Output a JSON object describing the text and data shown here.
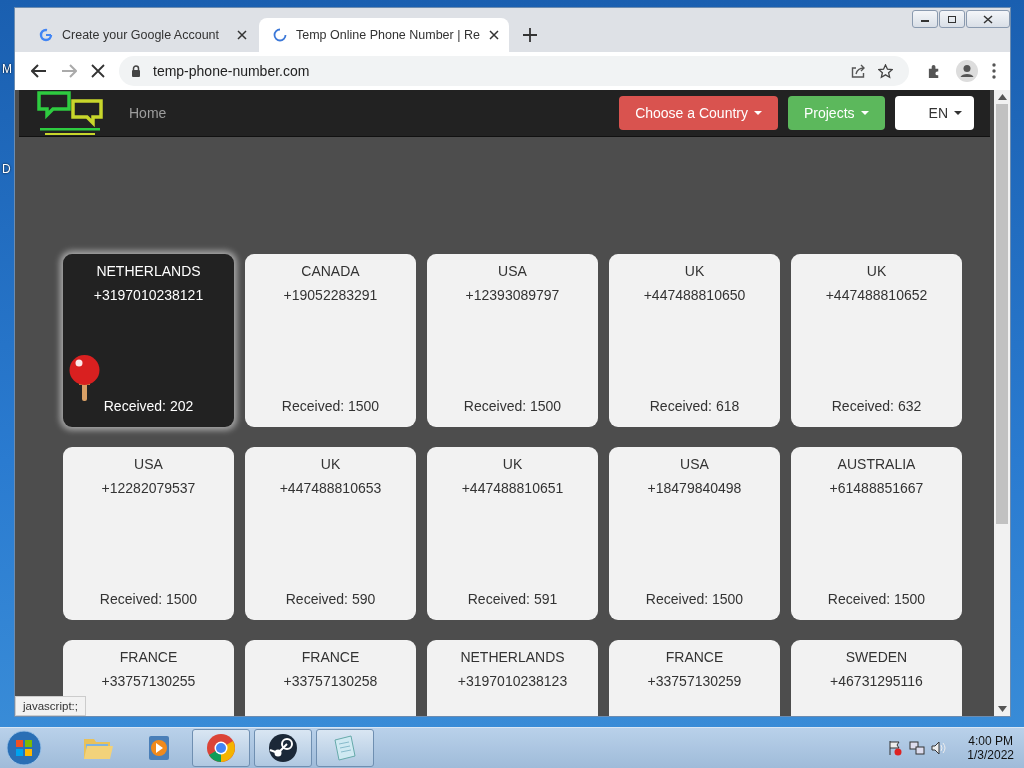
{
  "desktop_labels": [
    "M",
    "D"
  ],
  "browser": {
    "tabs": [
      {
        "title": "Create your Google Account",
        "selected": false,
        "loading": false
      },
      {
        "title": "Temp Online Phone Number | Re",
        "selected": true,
        "loading": true
      }
    ],
    "address": "temp-phone-number.com",
    "loading": true,
    "status_text": "javascript:;"
  },
  "page": {
    "nav": {
      "home": "Home",
      "buttons": [
        {
          "label": "Choose a Country",
          "color": "#d9534f"
        },
        {
          "label": "Projects",
          "color": "#5cb85c"
        },
        {
          "label": "EN",
          "color": "#ffffff"
        }
      ]
    },
    "cards": [
      {
        "country": "NETHERLANDS",
        "number": "+3197010238121",
        "received": "Received: 202",
        "highlighted": true
      },
      {
        "country": "CANADA",
        "number": "+19052283291",
        "received": "Received: 1500",
        "highlighted": false
      },
      {
        "country": "USA",
        "number": "+12393089797",
        "received": "Received: 1500",
        "highlighted": false
      },
      {
        "country": "UK",
        "number": "+447488810650",
        "received": "Received: 618",
        "highlighted": false
      },
      {
        "country": "UK",
        "number": "+447488810652",
        "received": "Received: 632",
        "highlighted": false
      },
      {
        "country": "USA",
        "number": "+12282079537",
        "received": "Received: 1500",
        "highlighted": false
      },
      {
        "country": "UK",
        "number": "+447488810653",
        "received": "Received: 590",
        "highlighted": false
      },
      {
        "country": "UK",
        "number": "+447488810651",
        "received": "Received: 591",
        "highlighted": false
      },
      {
        "country": "USA",
        "number": "+18479840498",
        "received": "Received: 1500",
        "highlighted": false
      },
      {
        "country": "AUSTRALIA",
        "number": "+61488851667",
        "received": "Received: 1500",
        "highlighted": false
      },
      {
        "country": "FRANCE",
        "number": "+33757130255",
        "highlighted": false
      },
      {
        "country": "FRANCE",
        "number": "+33757130258",
        "highlighted": false
      },
      {
        "country": "NETHERLANDS",
        "number": "+3197010238123",
        "highlighted": false
      },
      {
        "country": "FRANCE",
        "number": "+33757130259",
        "highlighted": false
      },
      {
        "country": "SWEDEN",
        "number": "+46731295116",
        "highlighted": false
      }
    ]
  },
  "taskbar": {
    "apps": [
      {
        "kind": "folder",
        "active": false
      },
      {
        "kind": "media",
        "active": false
      },
      {
        "kind": "chrome",
        "active": true
      },
      {
        "kind": "steam",
        "active": true
      },
      {
        "kind": "notepad",
        "active": true
      }
    ],
    "time": "4:00 PM",
    "date": "1/3/2022"
  }
}
